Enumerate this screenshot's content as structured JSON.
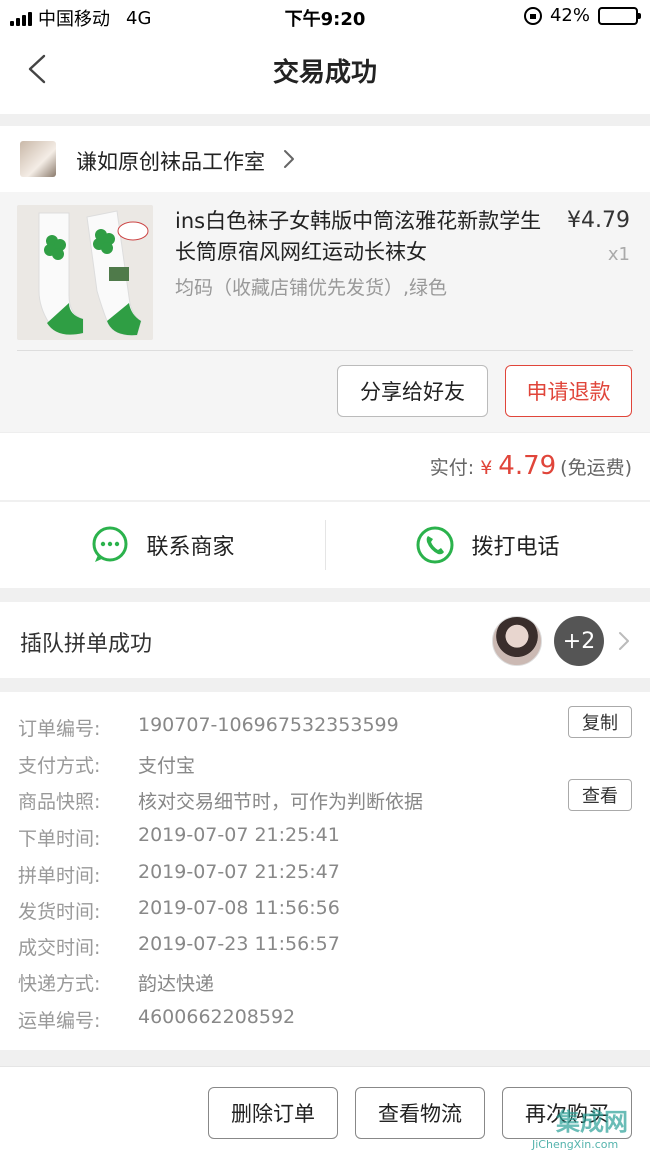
{
  "status_bar": {
    "carrier": "中国移动",
    "network": "4G",
    "time": "下午9:20",
    "battery_text": "42%",
    "battery_level": 0.42
  },
  "nav": {
    "title": "交易成功"
  },
  "shop": {
    "name": "谦如原创袜品工作室"
  },
  "product": {
    "title": "ins白色袜子女韩版中筒泫雅花新款学生长筒原宿风网红运动长袜女",
    "price": "¥4.79",
    "quantity": "x1",
    "spec": "均码（收藏店铺优先发货）,绿色",
    "image_tag": "绿色小花"
  },
  "actions": {
    "share_label": "分享给好友",
    "refund_label": "申请退款"
  },
  "payment": {
    "label": "实付:",
    "currency": "¥",
    "amount": "4.79",
    "note": "(免运费)"
  },
  "contact": {
    "merchant_label": "联系商家",
    "phone_label": "拨打电话"
  },
  "group": {
    "label": "插队拼单成功",
    "more_count": "+2"
  },
  "order_info": {
    "rows": [
      {
        "label": "订单编号:",
        "value": "190707-106967532353599",
        "button": "复制"
      },
      {
        "label": "支付方式:",
        "value": "支付宝"
      },
      {
        "label": "商品快照:",
        "value": "核对交易细节时，可作为判断依据",
        "button": "查看"
      },
      {
        "label": "下单时间:",
        "value": "2019-07-07 21:25:41"
      },
      {
        "label": "拼单时间:",
        "value": "2019-07-07 21:25:47"
      },
      {
        "label": "发货时间:",
        "value": "2019-07-08 11:56:56"
      },
      {
        "label": "成交时间:",
        "value": "2019-07-23 11:56:57"
      },
      {
        "label": "快递方式:",
        "value": "韵达快递"
      },
      {
        "label": "运单编号:",
        "value": "4600662208592"
      }
    ]
  },
  "bottom_actions": {
    "delete_label": "删除订单",
    "logistics_label": "查看物流",
    "rebuy_label": "再次购买"
  },
  "watermark": {
    "brand": "集成网",
    "url": "JiChengXin.com"
  },
  "colors": {
    "accent_red": "#e0453a",
    "wechat_green": "#2bb24c"
  }
}
